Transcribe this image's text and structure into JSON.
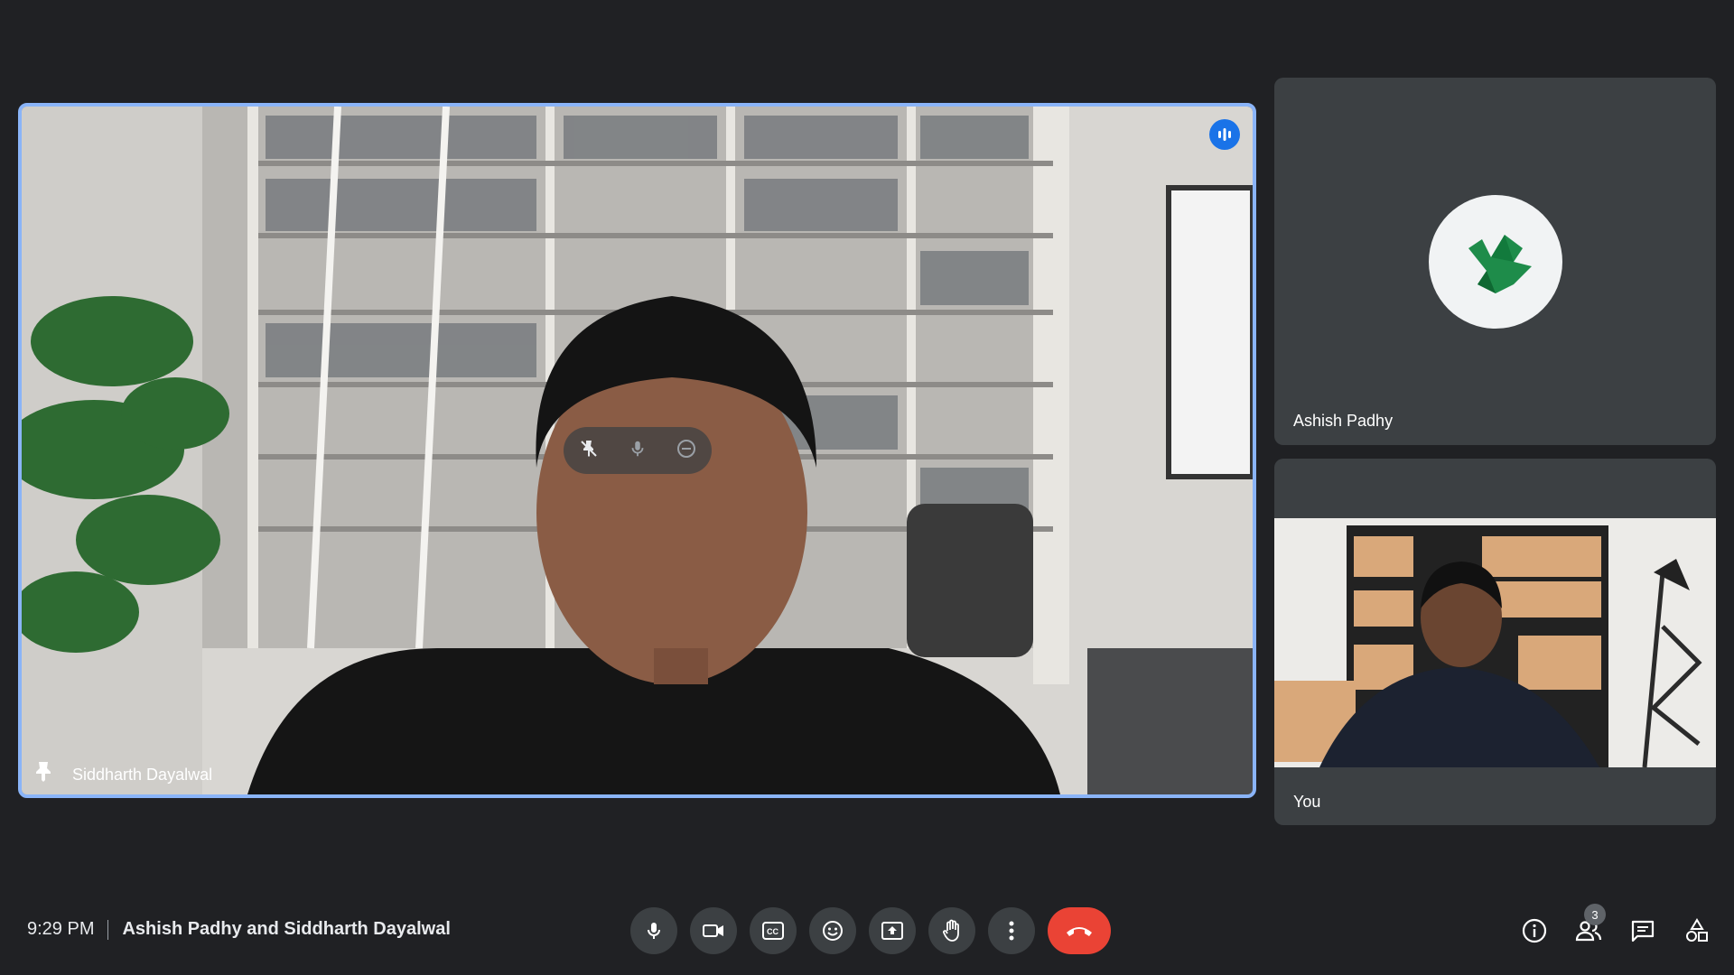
{
  "participants": {
    "main": {
      "name": "Siddharth Dayalwal"
    },
    "side": [
      {
        "name": "Ashish Padhy"
      },
      {
        "name": "You"
      }
    ]
  },
  "meeting": {
    "time": "9:29 PM",
    "title": "Ashish Padhy and Siddharth Dayalwal"
  },
  "people_count": "3",
  "icons": {
    "mic": "mic-icon",
    "camera": "videocam-icon",
    "captions": "closed-caption-icon",
    "reactions": "emoji-icon",
    "present": "present-screen-icon",
    "raise_hand": "hand-icon",
    "more": "more-vert-icon",
    "end_call": "phone-hangup-icon",
    "info": "info-icon",
    "people": "people-icon",
    "chat": "chat-icon",
    "activities": "shapes-icon",
    "pin": "pin-icon",
    "speaking": "audio-level-icon"
  },
  "colors": {
    "background": "#202124",
    "tile": "#3c4043",
    "highlight": "#8ab4f8",
    "end_call": "#ea4335",
    "speaking": "#1a73e8"
  }
}
